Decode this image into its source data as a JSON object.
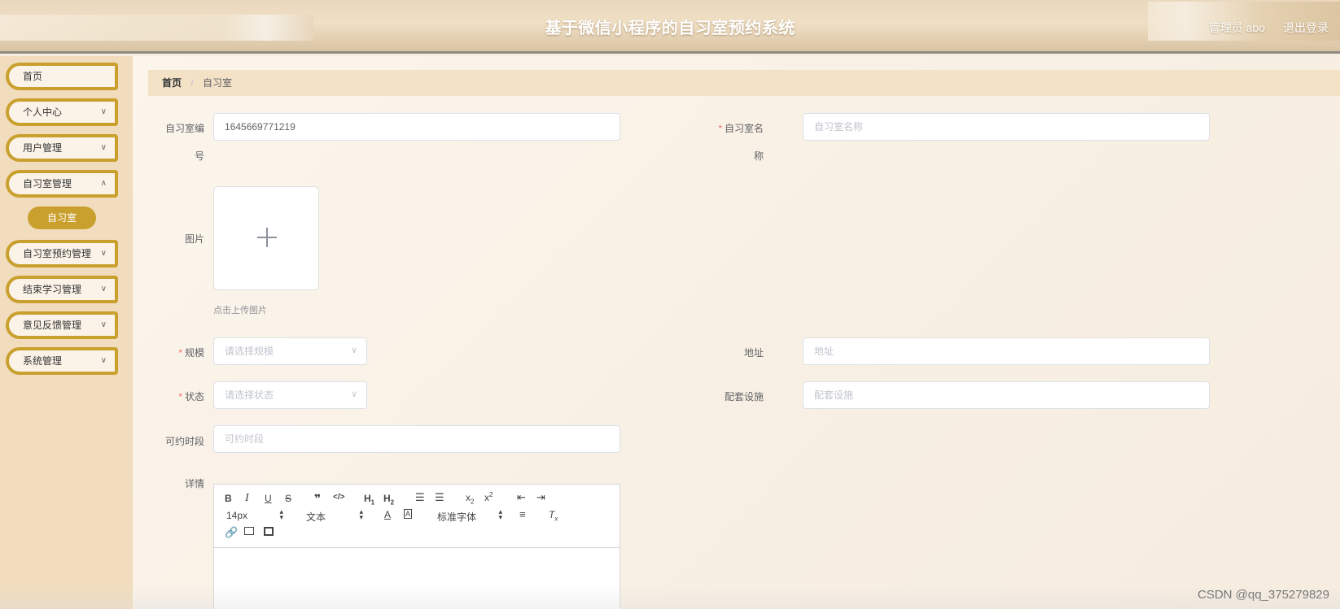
{
  "header": {
    "title": "基于微信小程序的自习室预约系统",
    "user": "管理员 abo",
    "logout": "退出登录"
  },
  "sidebar": {
    "items": [
      {
        "label": "首页",
        "has_children": false
      },
      {
        "label": "个人中心",
        "has_children": true
      },
      {
        "label": "用户管理",
        "has_children": true
      },
      {
        "label": "自习室管理",
        "has_children": true
      },
      {
        "label": "自习室预约管理",
        "has_children": true
      },
      {
        "label": "结束学习管理",
        "has_children": true
      },
      {
        "label": "意见反馈管理",
        "has_children": true
      },
      {
        "label": "系统管理",
        "has_children": true
      }
    ],
    "active_sub": "自习室"
  },
  "breadcrumb": {
    "home": "首页",
    "separator": "/",
    "current": "自习室"
  },
  "form": {
    "room_no": {
      "label_line1": "自习室编",
      "label_line2": "号",
      "value": "1645669771219"
    },
    "room_name": {
      "label_line1": "自习室名",
      "label_line2": "称",
      "placeholder": "自习室名称",
      "required": true
    },
    "image": {
      "label": "图片",
      "hint": "点击上传图片"
    },
    "scale": {
      "label": "规模",
      "placeholder": "请选择规模",
      "required": true
    },
    "address": {
      "label": "地址",
      "placeholder": "地址"
    },
    "status": {
      "label": "状态",
      "placeholder": "请选择状态",
      "required": true
    },
    "facilities": {
      "label": "配套设施",
      "placeholder": "配套设施"
    },
    "time_slot": {
      "label": "可约时段",
      "placeholder": "可约时段"
    },
    "details": {
      "label": "详情"
    }
  },
  "editor": {
    "font_size": "14px",
    "text_type": "文本",
    "font_family": "标准字体",
    "buttons": [
      "B",
      "I",
      "U",
      "S",
      "❞",
      "</>",
      "H1",
      "H2",
      "ordered-list",
      "bullet-list",
      "X2",
      "X2",
      "outdent",
      "indent",
      "A",
      "A",
      "align",
      "Tx",
      "link",
      "image",
      "video"
    ]
  },
  "watermark": "CSDN @qq_375279829",
  "colors": {
    "accent": "#c9a02e",
    "sidebar_bg": "#f1dcbd",
    "breadcrumb_bg": "#f4e2c7",
    "required": "#f56c6c"
  }
}
